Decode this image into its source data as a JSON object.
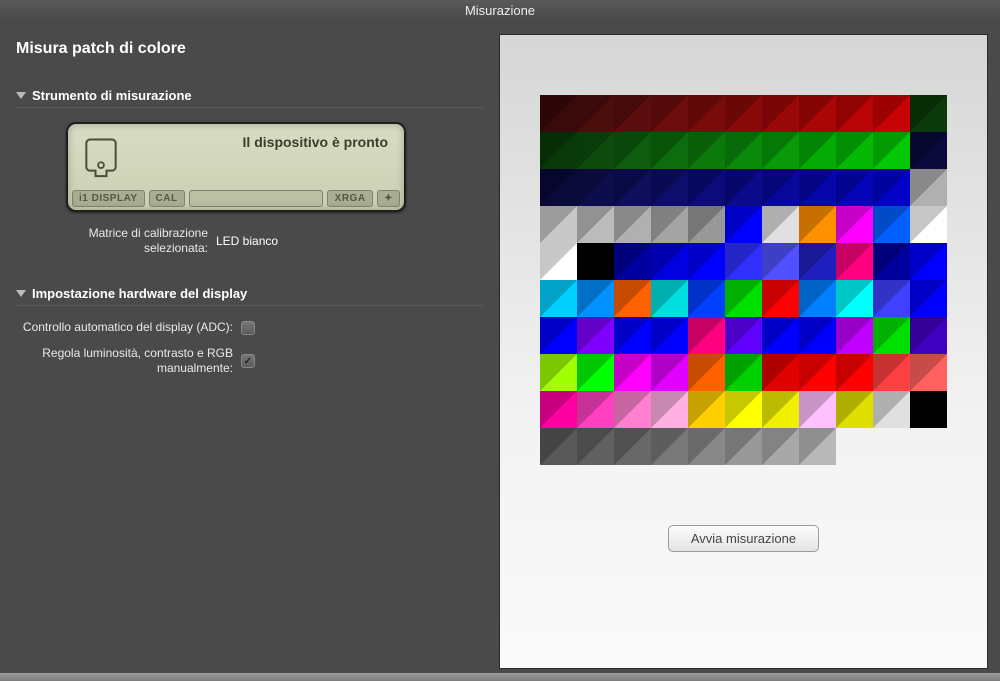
{
  "window": {
    "title": "Misurazione"
  },
  "page": {
    "title": "Misura patch di colore"
  },
  "sections": {
    "instrument": {
      "header": "Strumento di misurazione",
      "device_status": "Il dispositivo è pronto",
      "lcd_buttons": {
        "display": "i1 DISPLAY",
        "cal": "CAL",
        "xrga": "XRGA"
      },
      "calibration_label": "Matrice di calibrazione\nselezionata:",
      "calibration_value": "LED bianco"
    },
    "hardware": {
      "header": "Impostazione hardware del display",
      "adc_label": "Controllo automatico del display (ADC):",
      "adc_checked": false,
      "manual_label": "Regola luminosità, contrasto e RGB manualmente:",
      "manual_checked": true
    }
  },
  "action": {
    "start_measurement": "Avvia misurazione"
  },
  "patches": [
    [
      "#3a0a0a",
      "#4c0d0d",
      "#5c0e0e",
      "#6c0d0d",
      "#7a0b0b",
      "#8a0a0a",
      "#9a0808",
      "#aa0606",
      "#b80404",
      "#c80303",
      "#0a3a0a"
    ],
    [
      "#0a3a0a",
      "#0d4c0d",
      "#0e5c0e",
      "#0d6c0d",
      "#0b7a0b",
      "#0a8a0a",
      "#089a08",
      "#06aa06",
      "#04b804",
      "#03c803",
      "#0a0a3a"
    ],
    [
      "#0a0a3a",
      "#0d0d4c",
      "#0e0e5c",
      "#0d0d6c",
      "#0b0b7a",
      "#0a0a8a",
      "#08089a",
      "#0606aa",
      "#0404b8",
      "#0303c8",
      "#b0b0b0"
    ],
    [
      "#c8c8c8",
      "#bcbcbc",
      "#b0b0b0",
      "#a4a4a4",
      "#989898",
      "#0000ff",
      "#e0e0e0",
      "#ff9000",
      "#ff00ff",
      "#0060ff",
      "#ffffff"
    ],
    [
      "#ffffff",
      "#000000",
      "#0000a0",
      "#0000e0",
      "#0000ff",
      "#3030ff",
      "#5050ff",
      "#2020c0",
      "#ff0080",
      "#0000a0",
      "#0000ff"
    ],
    [
      "#00d0ff",
      "#0090ff",
      "#ff6000",
      "#00e0e0",
      "#0040ff",
      "#00e000",
      "#ff0000",
      "#0080ff",
      "#00ffff",
      "#4040ff",
      "#0000ff"
    ],
    [
      "#0000ff",
      "#8000ff",
      "#0000ff",
      "#0000ff",
      "#ff0080",
      "#6000ff",
      "#0000ff",
      "#0000ff",
      "#c000ff",
      "#00e000",
      "#4000c0"
    ],
    [
      "#a0ff00",
      "#00ff00",
      "#ff00ff",
      "#e000ff",
      "#ff6000",
      "#00d000",
      "#e00000",
      "#ff0000",
      "#ff0000",
      "#ff4040",
      "#ff6060"
    ],
    [
      "#ff00a0",
      "#ff40c0",
      "#ff80d0",
      "#ffb0e0",
      "#ffd000",
      "#ffff00",
      "#f0f000",
      "#ffc0ff",
      "#e0e000",
      "#e0e0e0",
      "#000000"
    ],
    [
      "#585858",
      "#606060",
      "#686868",
      "#787878",
      "#888888",
      "#989898",
      "#a8a8a8",
      "#b8b8b8",
      "",
      ""
    ]
  ]
}
